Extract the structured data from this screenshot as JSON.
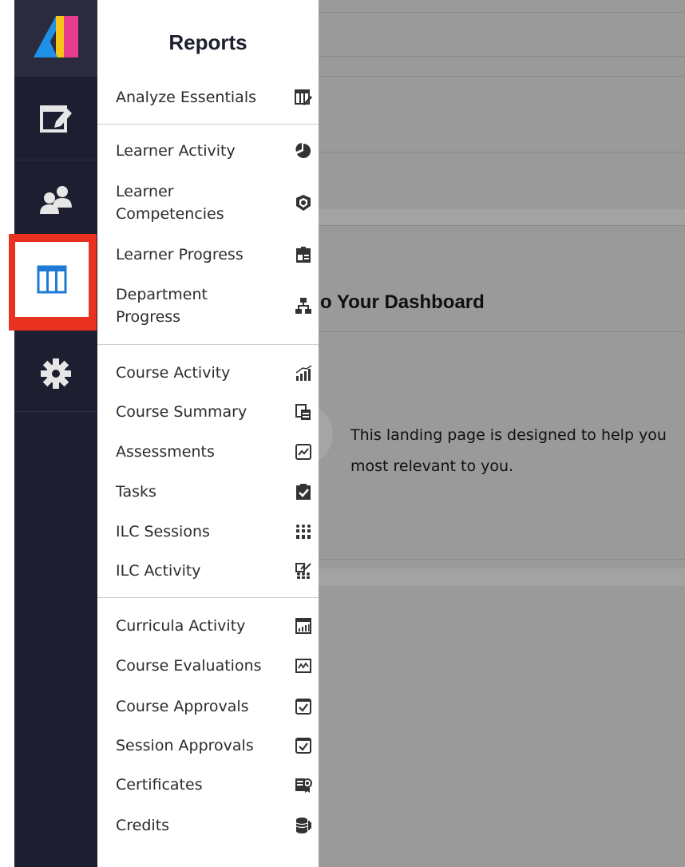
{
  "nav": {
    "logo_name": "brand-logo",
    "items": [
      {
        "id": "assignments",
        "icon": "edit-window-icon"
      },
      {
        "id": "users",
        "icon": "users-icon"
      },
      {
        "id": "reports",
        "icon": "columns-report-icon",
        "active": true
      },
      {
        "id": "settings",
        "icon": "gear-icon"
      }
    ],
    "active_outline_color": "#e8321f",
    "active_icon_color": "#1f7ad6"
  },
  "menu": {
    "title": "Reports",
    "groups": [
      [
        {
          "label": "Analyze Essentials",
          "icon": "analyze-essentials-icon"
        }
      ],
      [
        {
          "label": "Learner Activity",
          "icon": "pie-chart-icon"
        },
        {
          "label": "Learner\nCompetencies",
          "icon": "badge-shield-icon"
        },
        {
          "label": "Learner Progress",
          "icon": "clipboard-id-icon"
        },
        {
          "label": "Department\nProgress",
          "icon": "org-chart-icon"
        }
      ],
      [
        {
          "label": "Course Activity",
          "icon": "bar-growth-icon"
        },
        {
          "label": "Course Summary",
          "icon": "copy-document-icon"
        },
        {
          "label": "Assessments",
          "icon": "line-chart-icon"
        },
        {
          "label": "Tasks",
          "icon": "clipboard-check-icon"
        },
        {
          "label": "ILC Sessions",
          "icon": "attendees-grid-icon"
        },
        {
          "label": "ILC Activity",
          "icon": "checklist-people-icon"
        }
      ],
      [
        {
          "label": "Curricula Activity",
          "icon": "area-chart-icon"
        },
        {
          "label": "Course Evaluations",
          "icon": "trend-chart-icon"
        },
        {
          "label": "Course Approvals",
          "icon": "checkbox-icon"
        },
        {
          "label": "Session Approvals",
          "icon": "checkbox-icon"
        },
        {
          "label": "Certificates",
          "icon": "certificate-icon"
        },
        {
          "label": "Credits",
          "icon": "coin-stack-icon"
        }
      ]
    ]
  },
  "background": {
    "heading": "o Your Dashboard",
    "text_line1": "This landing page is designed to help you",
    "text_line2": "most relevant to you."
  }
}
